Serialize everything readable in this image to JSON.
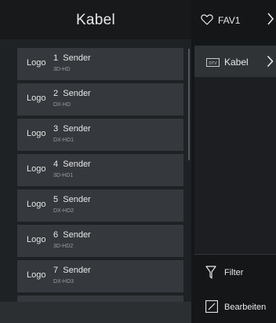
{
  "left_panel": {
    "title": "Kabel",
    "channels": [
      {
        "logo": "Logo",
        "number": "1",
        "name": "Sender",
        "type": "3D-HD"
      },
      {
        "logo": "Logo",
        "number": "2",
        "name": "Sender",
        "type": "DX-HD"
      },
      {
        "logo": "Logo",
        "number": "3",
        "name": "Sender",
        "type": "DX-HD1"
      },
      {
        "logo": "Logo",
        "number": "4",
        "name": "Sender",
        "type": "3D-HD1"
      },
      {
        "logo": "Logo",
        "number": "5",
        "name": "Sender",
        "type": "DX-HD2"
      },
      {
        "logo": "Logo",
        "number": "6",
        "name": "Sender",
        "type": "3D-HD2"
      },
      {
        "logo": "Logo",
        "number": "7",
        "name": "Sender",
        "type": "DX-HD3"
      }
    ]
  },
  "right_panel": {
    "fav_tab": {
      "label": "FAV1",
      "icon": "heart-outline-icon"
    },
    "list_item": {
      "label": "Kabel",
      "icon": "tv-icon"
    },
    "filter": {
      "label": "Filter",
      "icon": "filter-icon"
    },
    "edit": {
      "label": "Bearbeiten",
      "icon": "edit-icon"
    }
  },
  "colors": {
    "background": "#141618",
    "row": "#35383c",
    "selected": "#2f3336",
    "text": "#e8e8e8",
    "subtext": "#9a9da1"
  }
}
